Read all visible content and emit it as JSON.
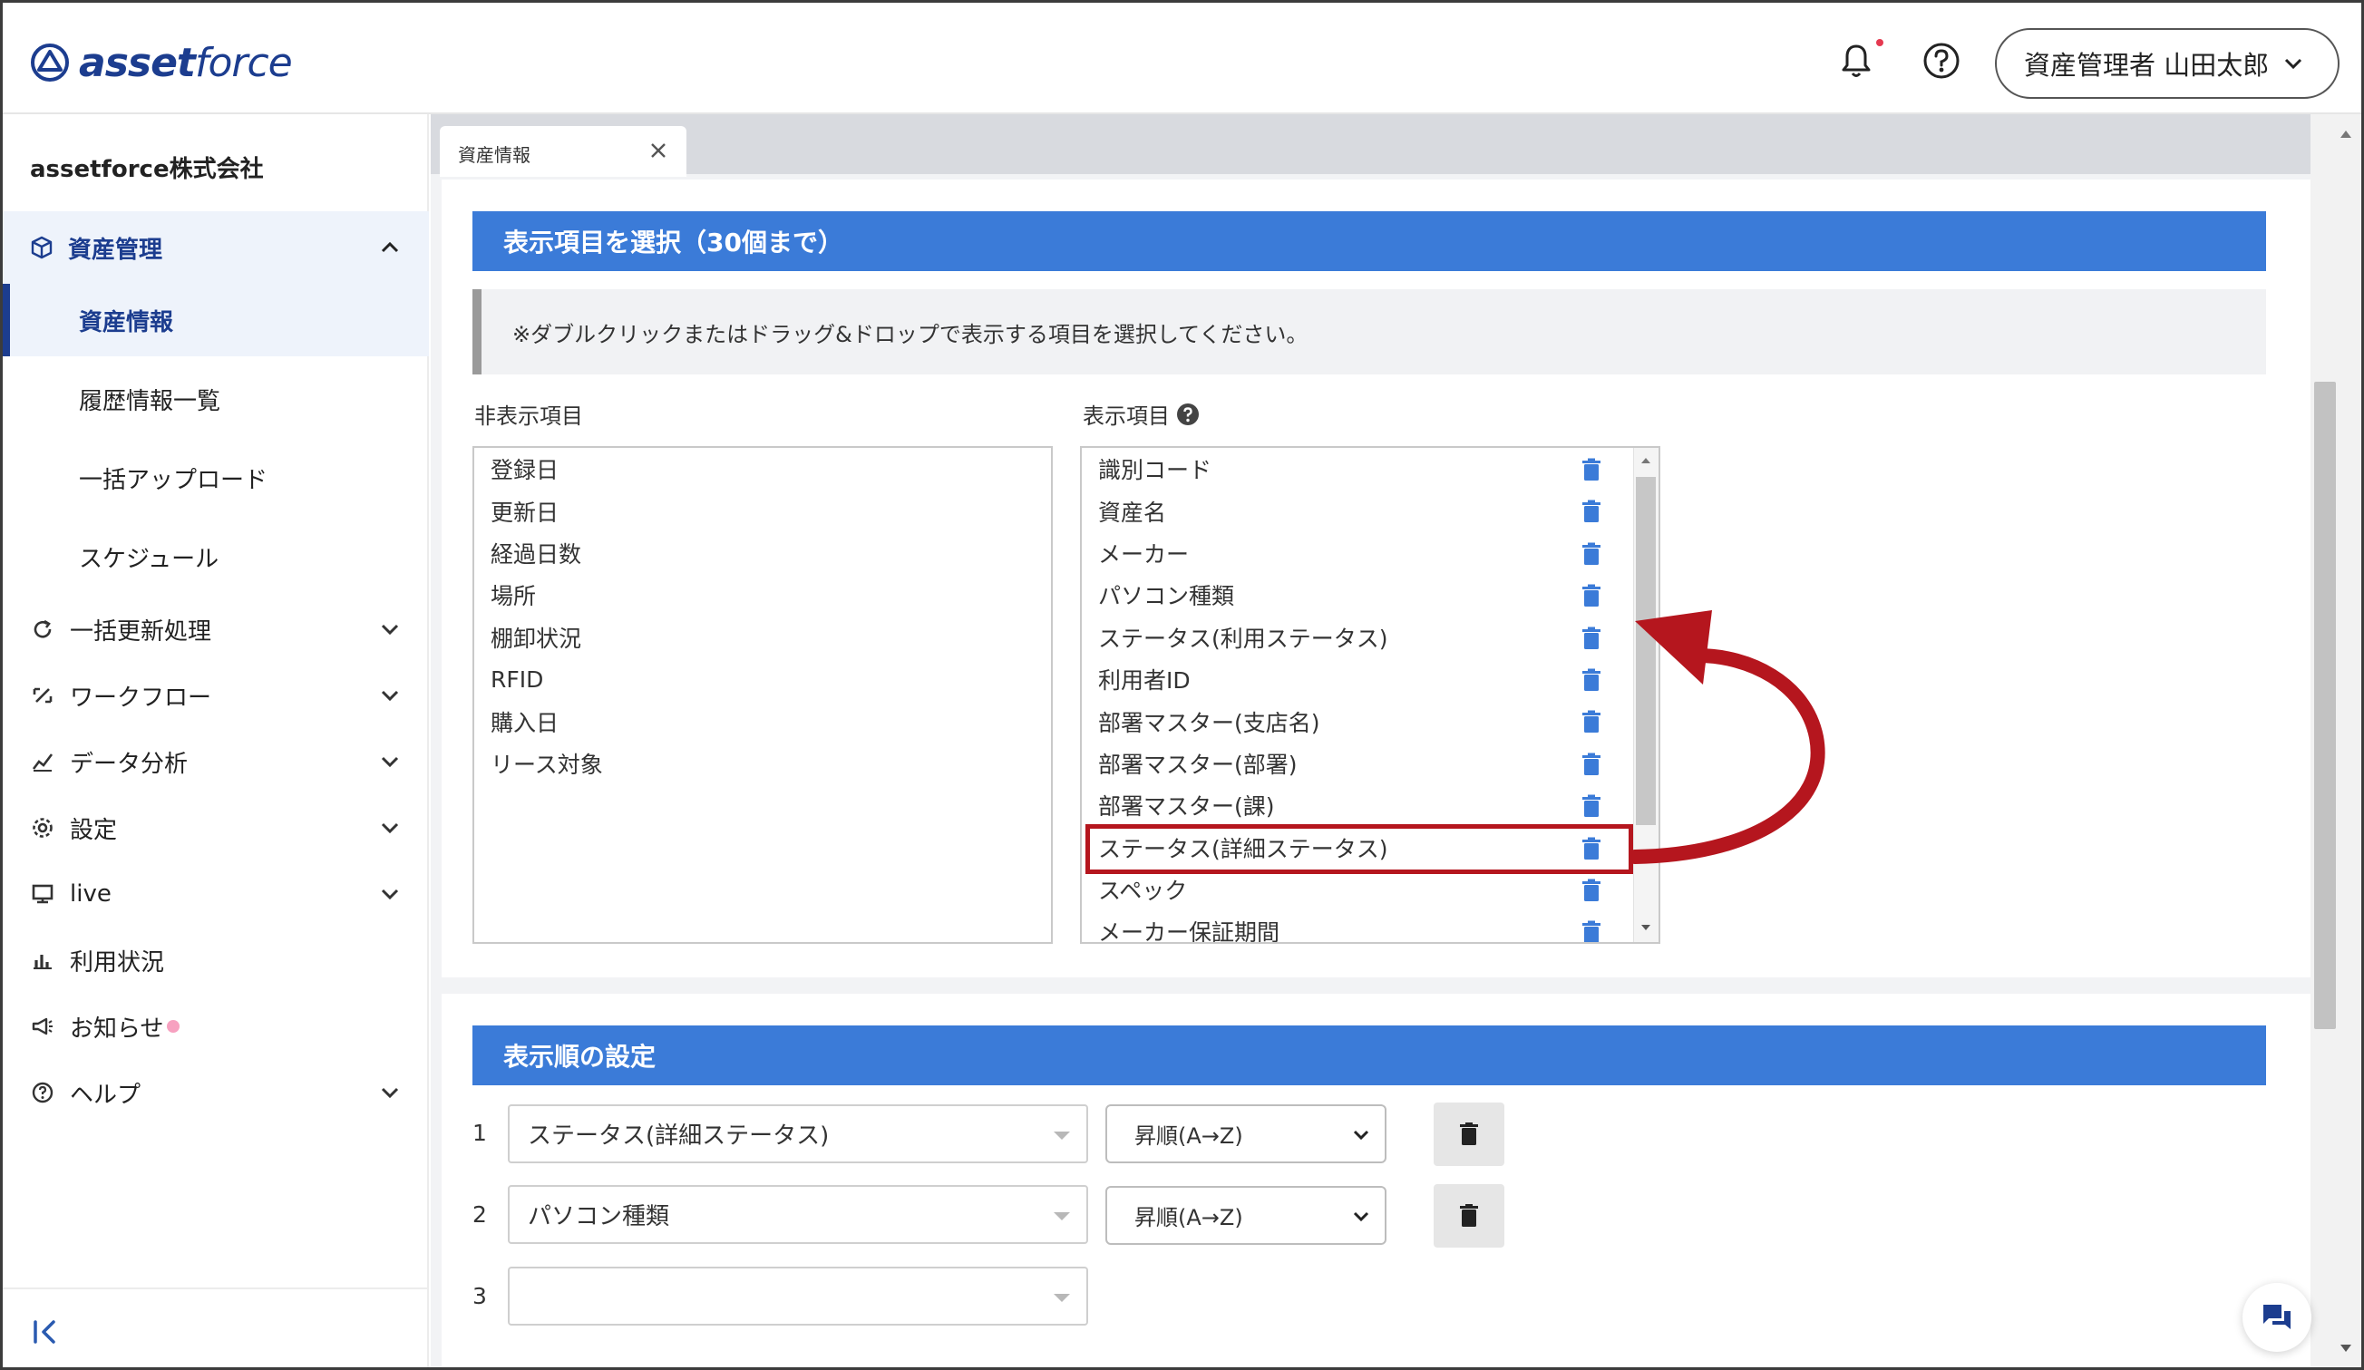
{
  "header": {
    "logo_text_bold": "asset",
    "logo_text_light": "force",
    "user_label": "資産管理者 山田太郎"
  },
  "sidebar": {
    "company": "assetforce株式会社",
    "group_label": "資産管理",
    "sub_items": [
      "資産情報",
      "履歴情報一覧",
      "一括アップロード",
      "スケジュール"
    ],
    "nav": [
      {
        "label": "一括更新処理",
        "icon": "refresh-icon"
      },
      {
        "label": "ワークフロー",
        "icon": "workflow-icon"
      },
      {
        "label": "データ分析",
        "icon": "analytics-icon"
      },
      {
        "label": "設定",
        "icon": "gear-icon"
      },
      {
        "label": "live",
        "icon": "live-icon"
      },
      {
        "label": "利用状況",
        "icon": "bar-chart-icon"
      },
      {
        "label": "お知らせ",
        "icon": "megaphone-icon"
      },
      {
        "label": "ヘルプ",
        "icon": "help-icon"
      }
    ]
  },
  "tab": {
    "label": "資産情報"
  },
  "select_section": {
    "title": "表示項目を選択（30個まで）",
    "notice": "※ダブルクリックまたはドラッグ&ドロップで表示する項目を選択してください。",
    "hidden_label": "非表示項目",
    "shown_label": "表示項目",
    "hidden_items": [
      "登録日",
      "更新日",
      "経過日数",
      "場所",
      "棚卸状況",
      "RFID",
      "購入日",
      "リース対象"
    ],
    "shown_items": [
      "識別コード",
      "資産名",
      "メーカー",
      "パソコン種類",
      "ステータス(利用ステータス)",
      "利用者ID",
      "部署マスター(支店名)",
      "部署マスター(部署)",
      "部署マスター(課)",
      "ステータス(詳細ステータス)",
      "スペック",
      "メーカー保証期間"
    ],
    "highlighted_item": "ステータス(詳細ステータス)"
  },
  "order_section": {
    "title": "表示順の設定",
    "rows": [
      {
        "num": "1",
        "field": "ステータス(詳細ステータス)",
        "direction": "昇順(A→Z)"
      },
      {
        "num": "2",
        "field": "パソコン種類",
        "direction": "昇順(A→Z)"
      },
      {
        "num": "3",
        "field": "",
        "direction": ""
      }
    ]
  },
  "colors": {
    "accent": "#3b7bd8",
    "brand": "#1c3d8f",
    "highlight": "#b5161e"
  }
}
